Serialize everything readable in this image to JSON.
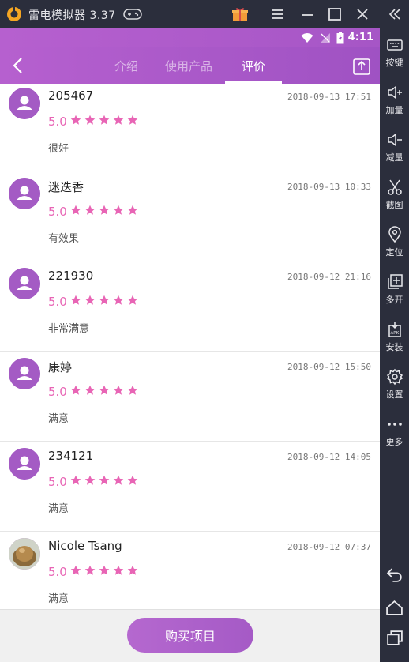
{
  "emulator": {
    "title": "雷电模拟器 3.37",
    "sidebar": [
      {
        "label": "按键",
        "icon": "keyboard-icon"
      },
      {
        "label": "加量",
        "icon": "volume-up-icon"
      },
      {
        "label": "减量",
        "icon": "volume-down-icon"
      },
      {
        "label": "截图",
        "icon": "scissors-icon"
      },
      {
        "label": "定位",
        "icon": "location-pin-icon"
      },
      {
        "label": "多开",
        "icon": "multi-instance-icon"
      },
      {
        "label": "安装",
        "icon": "apk-install-icon"
      },
      {
        "label": "设置",
        "icon": "gear-icon"
      },
      {
        "label": "更多",
        "icon": "more-dots-icon"
      }
    ],
    "nav_icons": [
      "back-nav-icon",
      "home-nav-icon",
      "recent-apps-icon"
    ]
  },
  "status": {
    "time": "4:11"
  },
  "appbar": {
    "tabs": [
      {
        "label": "介绍",
        "active": false
      },
      {
        "label": "使用产品",
        "active": false
      },
      {
        "label": "评价",
        "active": true
      }
    ]
  },
  "reviews": [
    {
      "user": "205467",
      "date": "2018-09-13 17:51",
      "score": "5.0",
      "stars": 5,
      "comment": "很好",
      "avatar": "default"
    },
    {
      "user": "迷迭香",
      "date": "2018-09-13 10:33",
      "score": "5.0",
      "stars": 5,
      "comment": "有效果",
      "avatar": "default"
    },
    {
      "user": "221930",
      "date": "2018-09-12 21:16",
      "score": "5.0",
      "stars": 5,
      "comment": "非常满意",
      "avatar": "default"
    },
    {
      "user": "康婷",
      "date": "2018-09-12 15:50",
      "score": "5.0",
      "stars": 5,
      "comment": "满意",
      "avatar": "default"
    },
    {
      "user": "234121",
      "date": "2018-09-12 14:05",
      "score": "5.0",
      "stars": 5,
      "comment": "满意",
      "avatar": "default"
    },
    {
      "user": "Nicole Tsang",
      "date": "2018-09-12 07:37",
      "score": "5.0",
      "stars": 5,
      "comment": "满意",
      "avatar": "photo"
    }
  ],
  "bottom": {
    "buy_label": "购买项目"
  },
  "colors": {
    "accent": "#a65ac6",
    "star": "#e865b5",
    "frame": "#2b2e3c"
  }
}
